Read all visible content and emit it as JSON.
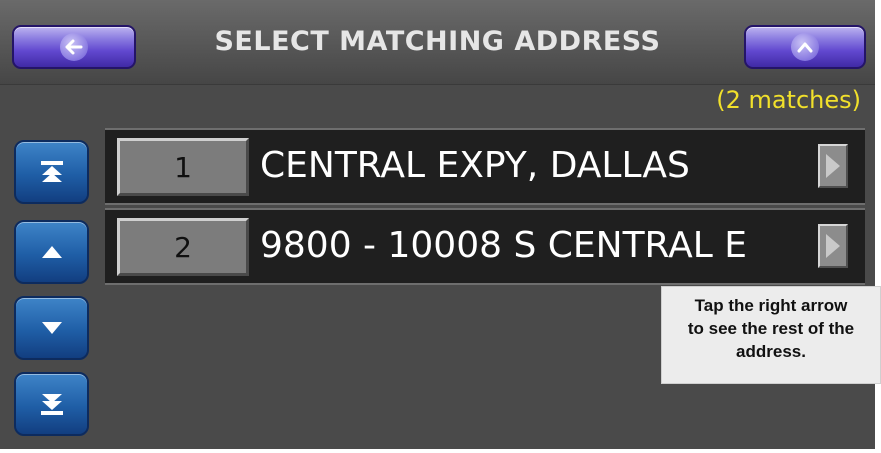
{
  "header": {
    "title": "SELECT MATCHING ADDRESS",
    "back_button_icon": "arrow-left-icon",
    "up_button_icon": "chevron-up-icon"
  },
  "results": {
    "count_text": "(2 matches)",
    "items": [
      {
        "number": "1",
        "address": "CENTRAL EXPY, DALLAS"
      },
      {
        "number": "2",
        "address": "9800 - 10008 S CENTRAL E"
      }
    ]
  },
  "scroll_buttons": [
    "scroll-to-top-icon",
    "scroll-up-icon",
    "scroll-down-icon",
    "scroll-to-bottom-icon"
  ],
  "tooltip": {
    "lines": [
      "Tap the right arrow",
      "to see the rest of the",
      "address."
    ]
  },
  "colors": {
    "background": "#4a4a4a",
    "header_button": "#6148cf",
    "scroll_button": "#1f5ea6",
    "match_count": "#f1e02b",
    "list_row": "#1f1f1f",
    "tooltip_background": "#ececec"
  }
}
